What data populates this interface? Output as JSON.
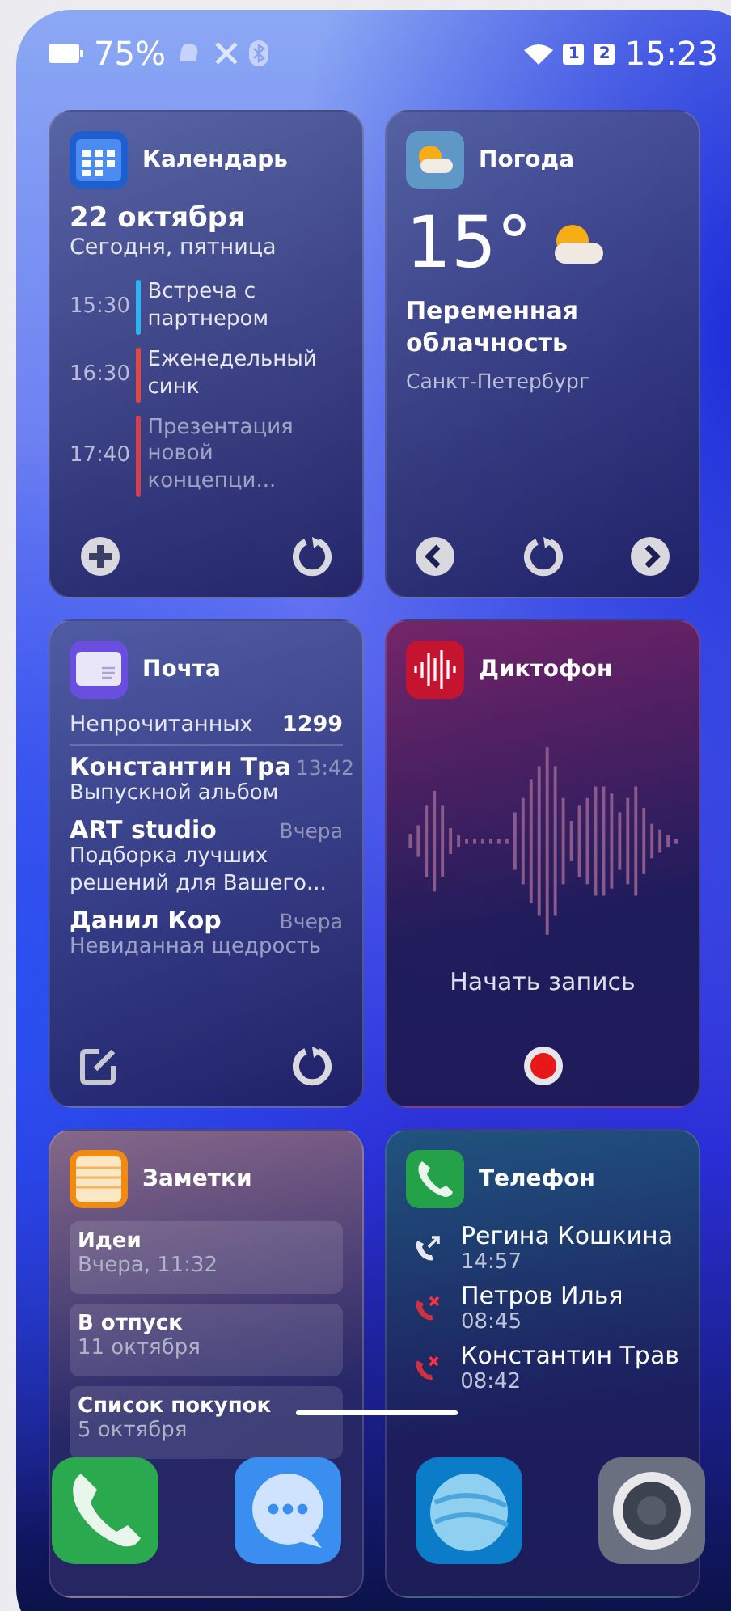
{
  "status_bar": {
    "battery": "75%",
    "sim_1": "1",
    "sim_2": "2",
    "time": "15:23"
  },
  "calendar": {
    "title": "Календарь",
    "date": "22 октября",
    "day": "Сегодня, пятница",
    "events": [
      {
        "time": "15:30",
        "title": "Встреча с партнером",
        "color": "#2fb4f0"
      },
      {
        "time": "16:30",
        "title": "Еженедельный синк",
        "color": "#e04848"
      },
      {
        "time": "17:40",
        "title": "Презентация новой концепци...",
        "color": "#d04050"
      }
    ]
  },
  "weather": {
    "title": "Погода",
    "temperature": "15°",
    "condition": "Переменная облачность",
    "city": "Санкт-Петербург"
  },
  "mail": {
    "title": "Почта",
    "unread_label": "Непрочитанных",
    "unread_count": "1299",
    "messages": [
      {
        "sender": "Константин Тра",
        "time": "13:42",
        "subject": "Выпускной альбом"
      },
      {
        "sender": "ART studio",
        "time": "Вчера",
        "subject": "Подборка лучших решений для Вашего..."
      },
      {
        "sender": "Данил Кор",
        "time": "Вчера",
        "subject": "Невиданная щедрость"
      }
    ]
  },
  "recorder": {
    "title": "Диктофон",
    "action": "Начать запись"
  },
  "notes": {
    "title": "Заметки",
    "items": [
      {
        "title": "Идеи",
        "date": "Вчера, 11:32"
      },
      {
        "title": "В отпуск",
        "date": "11 октября"
      },
      {
        "title": "Список покупок",
        "date": "5 октября"
      }
    ]
  },
  "phone": {
    "title": "Телефон",
    "calls": [
      {
        "kind": "outgoing",
        "name": "Регина Кошкина",
        "time": "14:57"
      },
      {
        "kind": "missed",
        "name": "Петров Илья",
        "time": "08:45"
      },
      {
        "kind": "missed",
        "name": "Константин Трав",
        "time": "08:42"
      }
    ]
  }
}
